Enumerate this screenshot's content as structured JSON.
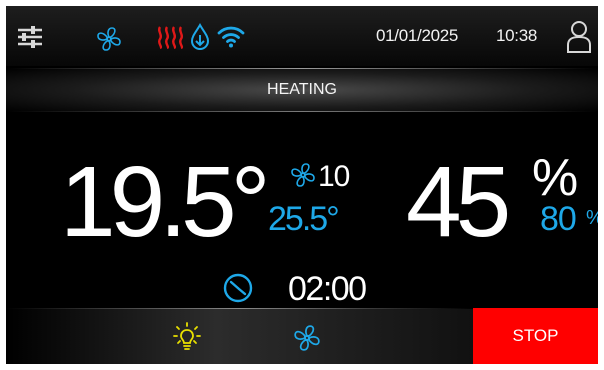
{
  "status_bar": {
    "date": "01/01/2025",
    "time": "10:38",
    "icons": [
      "settings-sliders-icon",
      "fan-icon",
      "heating-icon",
      "water-drop-icon",
      "wifi-icon",
      "user-icon"
    ]
  },
  "mode": {
    "label": "HEATING"
  },
  "temperature": {
    "current": "19.5°",
    "setpoint": "25.5°"
  },
  "fan": {
    "speed": "10"
  },
  "humidity": {
    "current": "45",
    "unit": "%",
    "setpoint": "80",
    "setpoint_unit": "%"
  },
  "timer": {
    "value": "02:00"
  },
  "bottom_bar": {
    "icons": [
      "light-bulb-icon",
      "fan-icon"
    ],
    "stop_label": "STOP"
  },
  "colors": {
    "accent_blue": "#1ea8e8",
    "heating_red": "#e01818",
    "light_yellow": "#e8e000",
    "stop_red": "#ff0000",
    "text_white": "#ffffff"
  }
}
